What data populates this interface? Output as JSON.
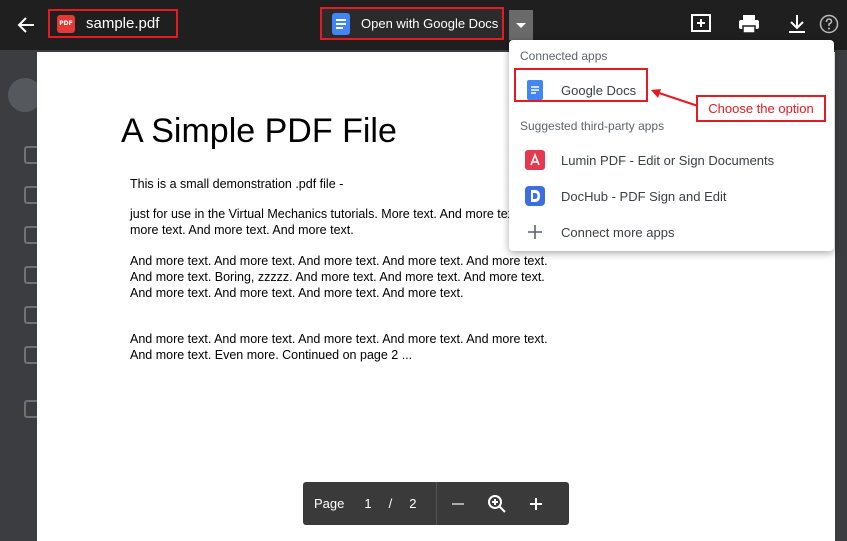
{
  "file": {
    "name": "sample.pdf",
    "badge": "PDF"
  },
  "open_with": {
    "label": "Open with Google Docs"
  },
  "menu": {
    "connected_heading": "Connected apps",
    "connected_items": [
      {
        "label": "Google Docs",
        "icon": "google-docs-icon"
      }
    ],
    "suggested_heading": "Suggested third-party apps",
    "suggested_items": [
      {
        "label": "Lumin PDF - Edit or Sign Documents",
        "icon": "lumin-pdf-icon"
      },
      {
        "label": "DocHub - PDF Sign and Edit",
        "icon": "dochub-icon"
      },
      {
        "label": "Connect more apps",
        "icon": "plus-icon"
      }
    ]
  },
  "callout": {
    "text": "Choose the option"
  },
  "document": {
    "title": "A Simple PDF File",
    "paragraphs": [
      "This is a small demonstration .pdf file -",
      "just for use in the Virtual Mechanics tutorials. More text. And more text. And more text. And more text. And more text.",
      "And more text. And more text. And more text. And more text. And more text. And more text. Boring, zzzzz. And more text. And more text. And more text. And more text. And more text. And more text. And more text.",
      "And more text. And more text. And more text. And more text. And more text. And more text. Even more. Continued on page 2 ..."
    ]
  },
  "pager": {
    "label": "Page",
    "current": "1",
    "separator": "/",
    "total": "2"
  },
  "colors": {
    "accent_red": "#e31b23",
    "docs_blue": "#4285f4",
    "topbar": "#1f1f1f"
  }
}
